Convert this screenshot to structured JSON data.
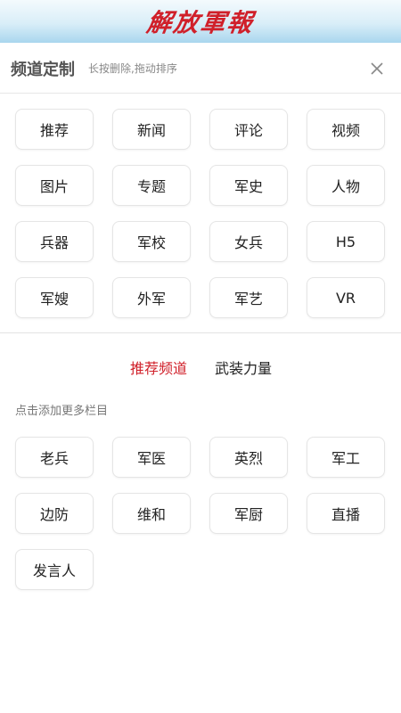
{
  "masthead": {
    "logo_text": "解放軍報"
  },
  "header": {
    "title": "频道定制",
    "hint": "长按删除,拖动排序",
    "close_icon": "close-icon"
  },
  "my_channels": [
    "推荐",
    "新闻",
    "评论",
    "视频",
    "图片",
    "专题",
    "军史",
    "人物",
    "兵器",
    "军校",
    "女兵",
    "H5",
    "军嫂",
    "外军",
    "军艺",
    "VR"
  ],
  "tabs": {
    "active": "推荐频道",
    "other": "武装力量"
  },
  "add_hint": "点击添加更多栏目",
  "more_channels": [
    "老兵",
    "军医",
    "英烈",
    "军工",
    "边防",
    "维和",
    "军厨",
    "直播",
    "发言人"
  ],
  "colors": {
    "accent": "#d0202a",
    "masthead_blue": "#a9d6ee"
  }
}
